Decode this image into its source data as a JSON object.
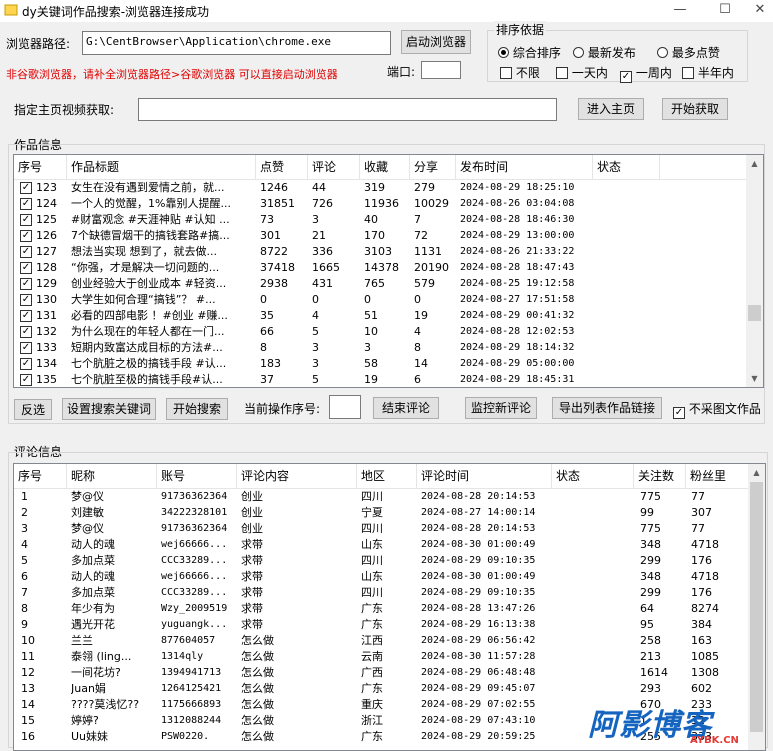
{
  "window": {
    "title": "dy关键词作品搜索-浏览器连接成功",
    "minimize_icon": "minimize-icon",
    "maximize_icon": "maximize-icon",
    "close_icon": "close-icon"
  },
  "browser": {
    "path_label": "浏览器路径:",
    "path_value": "G:\\CentBrowser\\Application\\chrome.exe",
    "launch_button": "启动浏览器",
    "hint": "非谷歌浏览器，请补全浏览器路径>谷歌浏览器 可以直接启动浏览器",
    "port_label": "端口:",
    "port_value": ""
  },
  "sort": {
    "title": "排序依据",
    "options": [
      {
        "label": "综合排序",
        "selected": true
      },
      {
        "label": "最新发布",
        "selected": false
      },
      {
        "label": "最多点赞",
        "selected": false
      }
    ],
    "ranges": [
      {
        "label": "不限",
        "checked": false
      },
      {
        "label": "一天内",
        "checked": false
      },
      {
        "label": "一周内",
        "checked": true
      },
      {
        "label": "半年内",
        "checked": false
      }
    ]
  },
  "homepage": {
    "label": "指定主页视频获取:",
    "value": "",
    "enter_button": "进入主页",
    "start_button": "开始获取"
  },
  "works": {
    "section_title": "作品信息",
    "headers": [
      "序号",
      "作品标题",
      "点赞",
      "评论",
      "收藏",
      "分享",
      "发布时间",
      "状态"
    ],
    "rows": [
      [
        "123",
        "女生在没有遇到爱情之前，就...",
        "1246",
        "44",
        "319",
        "279",
        "2024-08-29  18:25:10",
        ""
      ],
      [
        "124",
        "一个人的觉醒，1%靠别人提醒...",
        "31851",
        "726",
        "11936",
        "10029",
        "2024-08-26  03:04:08",
        ""
      ],
      [
        "125",
        "#财富观念 #天涯神贴 #认知 ...",
        "73",
        "3",
        "40",
        "7",
        "2024-08-28  18:46:30",
        ""
      ],
      [
        "126",
        "7个缺德冒烟干的搞钱套路#搞...",
        "301",
        "21",
        "170",
        "72",
        "2024-08-29  13:00:00",
        ""
      ],
      [
        "127",
        "想法当实现 想到了，就去做...",
        "8722",
        "336",
        "3103",
        "1131",
        "2024-08-26  21:33:22",
        ""
      ],
      [
        "128",
        "“你强，才是解决一切问题的...",
        "37418",
        "1665",
        "14378",
        "20190",
        "2024-08-28  18:47:43",
        ""
      ],
      [
        "129",
        "创业经验大于创业成本 #轻资...",
        "2938",
        "431",
        "765",
        "579",
        "2024-08-25  19:12:58",
        ""
      ],
      [
        "130",
        "大学生如何合理“搞钱”？ #...",
        "0",
        "0",
        "0",
        "0",
        "2024-08-27  17:51:58",
        ""
      ],
      [
        "131",
        "必看的四部电影 ！#创业 #赚...",
        "35",
        "4",
        "51",
        "19",
        "2024-08-29  00:41:32",
        ""
      ],
      [
        "132",
        "为什么现在的年轻人都在一门...",
        "66",
        "5",
        "10",
        "4",
        "2024-08-28  12:02:53",
        ""
      ],
      [
        "133",
        "短期内致富达成目标的方法#...",
        "8",
        "3",
        "3",
        "8",
        "2024-08-29  18:14:32",
        ""
      ],
      [
        "134",
        "七个肮脏之极的搞钱手段 #认...",
        "183",
        "3",
        "58",
        "14",
        "2024-08-29  05:00:00",
        ""
      ],
      [
        "135",
        "七个肮脏至极的搞钱手段#认...",
        "37",
        "5",
        "19",
        "6",
        "2024-08-29  18:45:31",
        ""
      ]
    ]
  },
  "toolbar": {
    "invert_button": "反选",
    "set_keyword_button": "设置搜索关键词",
    "start_search_button": "开始搜索",
    "current_seq_label": "当前操作序号:",
    "current_seq_value": "",
    "end_comment_button": "结束评论",
    "monitor_button": "监控新评论",
    "export_button": "导出列表作品链接",
    "no_image_label": "不采图文作品",
    "no_image_checked": true
  },
  "comments": {
    "section_title": "评论信息",
    "headers": [
      "序号",
      "昵称",
      "账号",
      "评论内容",
      "地区",
      "评论时间",
      "状态",
      "关注数",
      "粉丝里"
    ],
    "rows": [
      [
        "1",
        "梦@仪",
        "91736362364",
        "创业",
        "四川",
        "2024-08-28  20:14:53",
        "",
        "775",
        "77"
      ],
      [
        "2",
        "刘建敏",
        "34222328101",
        "创业",
        "宁夏",
        "2024-08-27  14:00:14",
        "",
        "99",
        "307"
      ],
      [
        "3",
        "梦@仪",
        "91736362364",
        "创业",
        "四川",
        "2024-08-28  20:14:53",
        "",
        "775",
        "77"
      ],
      [
        "4",
        "动人的魂",
        "wej66666...",
        "求带",
        "山东",
        "2024-08-30  01:00:49",
        "",
        "348",
        "4718"
      ],
      [
        "5",
        "多加点菜",
        "CCC33289...",
        "求带",
        "四川",
        "2024-08-29  09:10:35",
        "",
        "299",
        "176"
      ],
      [
        "6",
        "动人的魂",
        "wej66666...",
        "求带",
        "山东",
        "2024-08-30  01:00:49",
        "",
        "348",
        "4718"
      ],
      [
        "7",
        "多加点菜",
        "CCC33289...",
        "求带",
        "四川",
        "2024-08-29  09:10:35",
        "",
        "299",
        "176"
      ],
      [
        "8",
        "年少有为",
        "Wzy_2009519",
        "求带",
        "广东",
        "2024-08-28  13:47:26",
        "",
        "64",
        "8274"
      ],
      [
        "9",
        "遇光开花",
        "yuguangk...",
        "求带",
        "广东",
        "2024-08-29  16:13:38",
        "",
        "95",
        "384"
      ],
      [
        "10",
        "兰兰",
        "877604057",
        "怎么做",
        "江西",
        "2024-08-29  06:56:42",
        "",
        "258",
        "163"
      ],
      [
        "11",
        "泰翎 (ling...",
        "1314qly",
        "怎么做",
        "云南",
        "2024-08-30  11:57:28",
        "",
        "213",
        "1085"
      ],
      [
        "12",
        "一间花坊?",
        "1394941713",
        "怎么做",
        "广西",
        "2024-08-29  06:48:48",
        "",
        "1614",
        "1308"
      ],
      [
        "13",
        "Juan娟",
        "1264125421",
        "怎么做",
        "广东",
        "2024-08-29  09:45:07",
        "",
        "293",
        "602"
      ],
      [
        "14",
        "????莫浅忆??",
        "1175666893",
        "怎么做",
        "重庆",
        "2024-08-29  07:02:55",
        "",
        "670",
        "233"
      ],
      [
        "15",
        "婷婷?",
        "1312088244",
        "怎么做",
        "浙江",
        "2024-08-29  07:43:10",
        "",
        "1",
        "32"
      ],
      [
        "16",
        "Uu妹妹",
        "PSW0220.",
        "怎么做",
        "广东",
        "2024-08-29  20:59:25",
        "",
        "255",
        "333"
      ]
    ]
  },
  "watermark": {
    "text": "阿影博客",
    "sub": "AYBK.CN"
  }
}
